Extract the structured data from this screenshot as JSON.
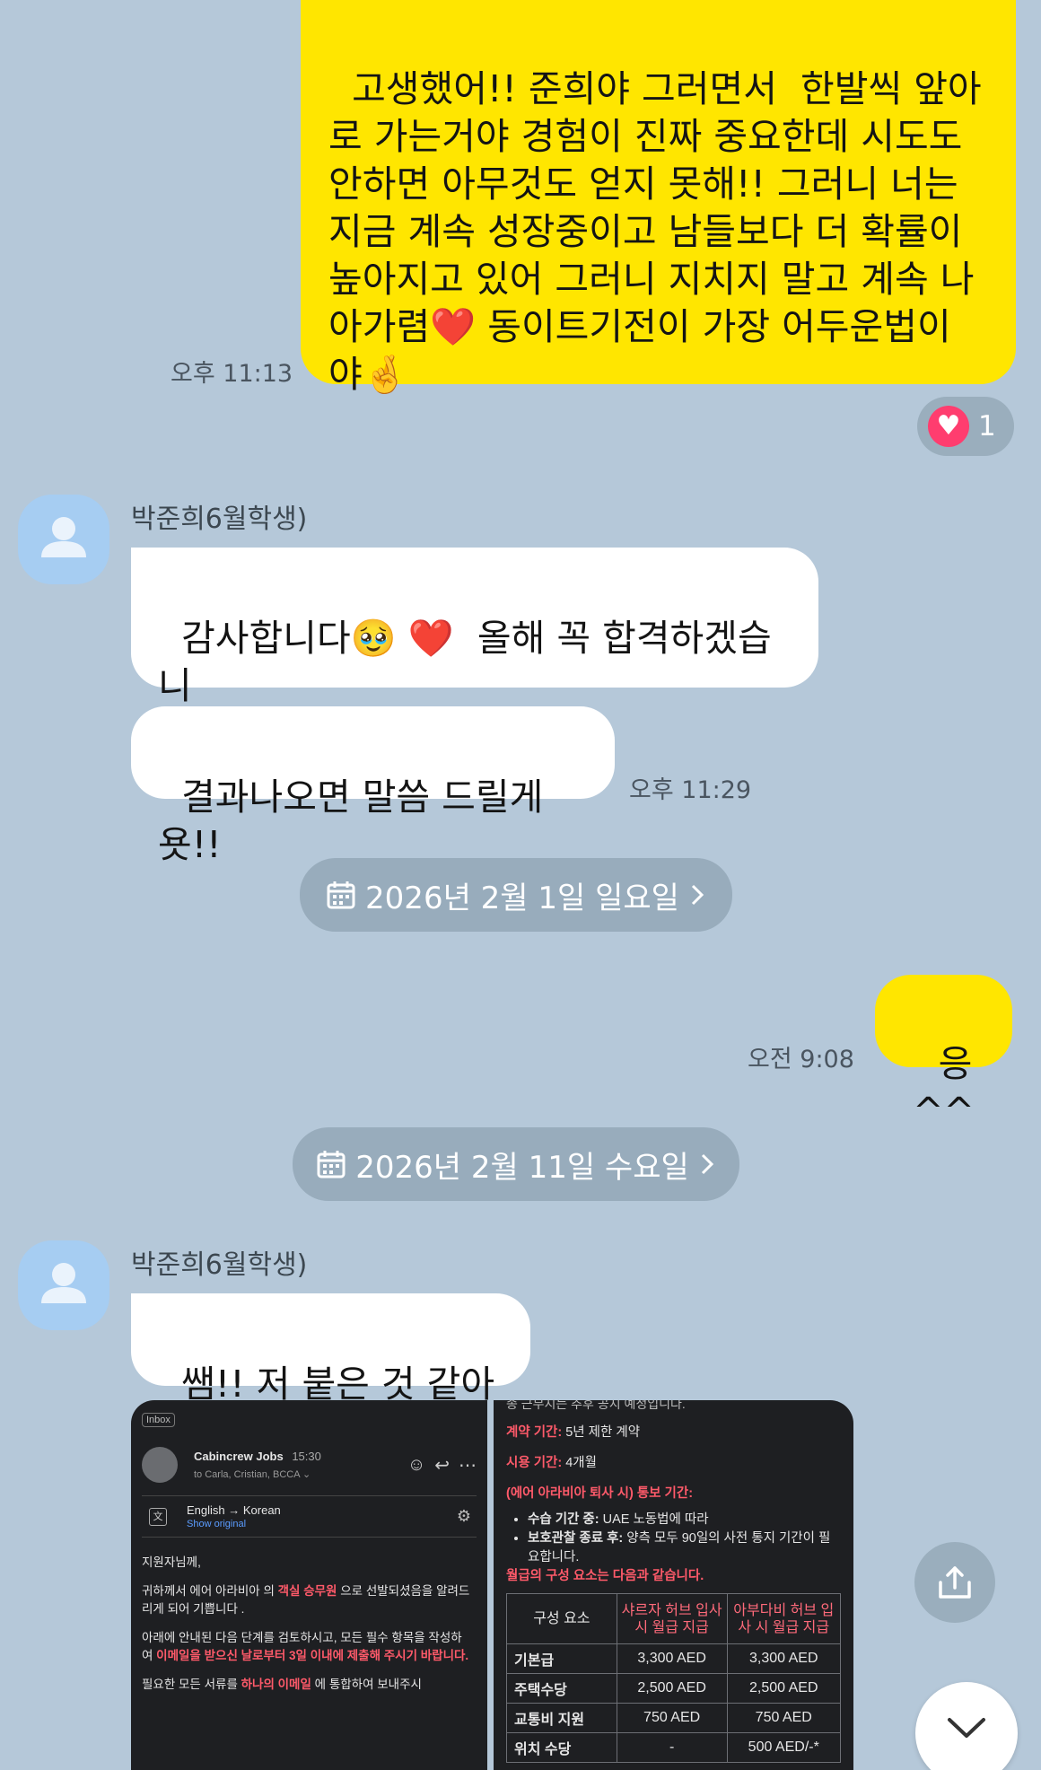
{
  "chat": {
    "msg1": {
      "text": "고생했어!! 준희야 그러면서  한발씩 앞아\n로 가는거야 경험이 진짜 중요한데 시도도\n안하면 아무것도 얻지 못해!! 그러니 너는\n지금 계속 성장중이고 남들보다 더 확률이\n높아지고 있어 그러니 지치지 말고 계속 나\n아가렴❤️ 동이트기전이 가장 어두운법이\n야🤞",
      "time": "오후 11:13",
      "reaction_count": "1"
    },
    "sender_name": "박준희6월학생)",
    "msg2": {
      "text": "감사합니다🥹 ❤️  올해 꼭 합격하겠습니\n다💪"
    },
    "msg3": {
      "text": "결과나오면 말씀 드릴게욧!!",
      "time": "오후 11:29"
    },
    "date1": "2026년 2월 1일 일요일",
    "msg4": {
      "text": "응^^",
      "time": "오전 9:08"
    },
    "date2": "2026년 2월 11일 수요일",
    "msg5": {
      "text": "쌤!! 저 붙은 것 같아요"
    },
    "photo_left": {
      "inbox_label": "Inbox",
      "from": "Cabincrew Jobs",
      "time": "15:30",
      "to": "to Carla, Cristian, BCCA ⌄",
      "translate": "English → Korean",
      "show_original": "Show original",
      "greeting": "지원자님께,",
      "p1_a": "귀하께서 에어 아라비아 의 ",
      "p1_red": "객실 승무원",
      "p1_b": " 으로 선발되셨음을 알려드리게 되어 기쁩니다 .",
      "p2_a": "아래에 안내된 다음 단계를 검토하시고, 모든 필수 항목을 작성하여 ",
      "p2_red": "이메일을 받으신 날로부터 3일 이내에 제출해 주시기 바랍니다.",
      "p3_a": "필요한 모든 서류를 ",
      "p3_red": "하나의 이메일",
      "p3_b": " 에 통합하여 보내주시"
    },
    "photo_right": {
      "top_cut": "종 근무지는 추후 공지 예정입니다.",
      "contract_label": "계약 기간:",
      "contract_value": " 5년 제한 계약",
      "probation_label": "시용 기간:",
      "probation_value": " 4개월",
      "notice_label": "(에어 아라비아 퇴사 시) 통보 기간:",
      "bullet1_label": "수습 기간 중:",
      "bullet1_value": " UAE 노동법에 따라",
      "bullet2_label": "보호관찰 종료 후:",
      "bullet2_value": " 양측 모두 90일의 사전 통지 기간이 필요합니다.",
      "salary_heading": "월급의 구성 요소는 다음과 같습니다.",
      "table": {
        "headers": [
          "구성 요소",
          "샤르자 허브 입사 시 월급 지급",
          "아부다비 허브 입사 시 월급 지급"
        ],
        "rows": [
          [
            "기본급",
            "3,300 AED",
            "3,300 AED"
          ],
          [
            "주택수당",
            "2,500 AED",
            "2,500 AED"
          ],
          [
            "교통비 지원",
            "750 AED",
            "750 AED"
          ],
          [
            "위치 수당",
            "-",
            "500 AED/-*"
          ]
        ]
      }
    }
  },
  "colors": {
    "background": "#b5c8d9",
    "my_bubble": "#ffe600",
    "other_bubble": "#ffffff",
    "avatar": "#a6cdf2",
    "date_pill": "#98acbc",
    "heart": "#ff3d6f"
  },
  "icons": {
    "calendar": "calendar-icon",
    "chevron": "chevron-right-icon",
    "share": "share-icon",
    "scroll_down": "chevron-down-icon",
    "avatar": "person-icon",
    "heart": "heart-icon"
  }
}
